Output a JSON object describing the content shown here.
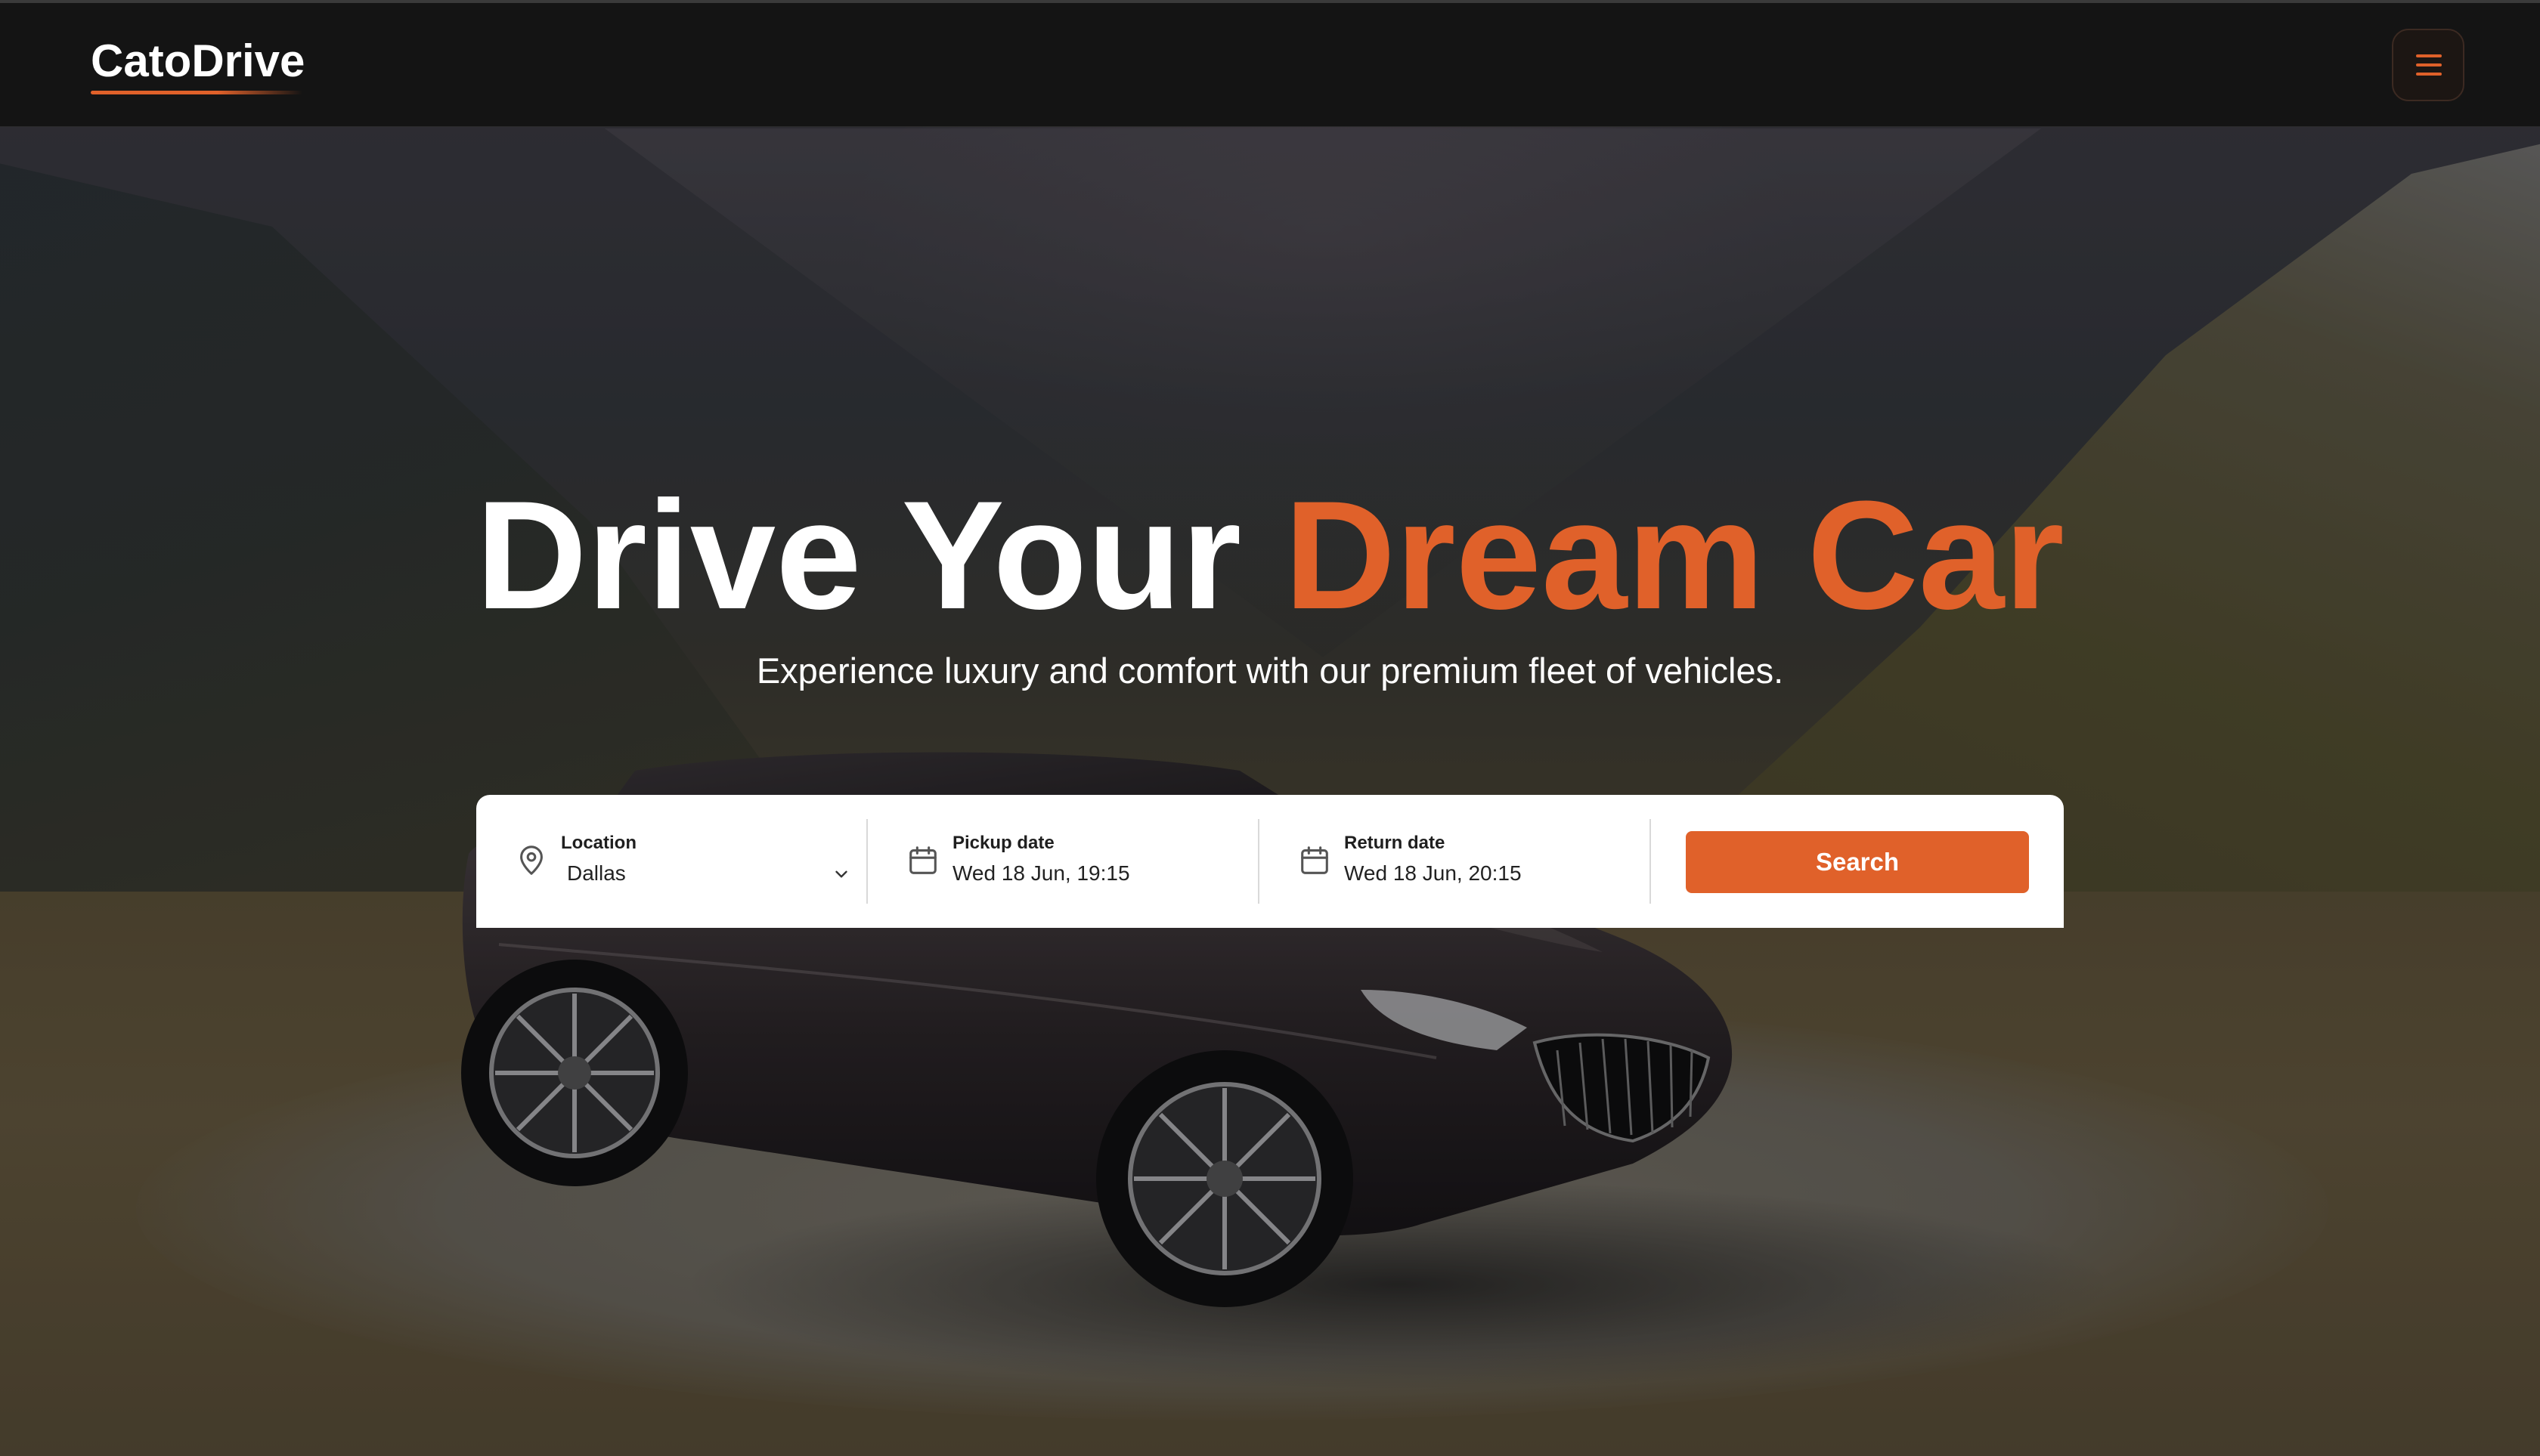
{
  "header": {
    "logo_text": "CatoDrive",
    "menu_icon": "hamburger-menu-icon"
  },
  "hero": {
    "title_part1": "Drive Your",
    "title_accent": "Dream Car",
    "subtitle": "Experience luxury and comfort with our premium fleet of vehicles."
  },
  "search": {
    "location": {
      "label": "Location",
      "value": "Dallas",
      "icon": "map-pin-icon"
    },
    "pickup": {
      "label": "Pickup date",
      "value": "Wed 18 Jun, 19:15",
      "icon": "calendar-icon"
    },
    "return": {
      "label": "Return date",
      "value": "Wed 18 Jun, 20:15",
      "icon": "calendar-icon"
    },
    "button_label": "Search"
  },
  "colors": {
    "accent": "#e0612a",
    "header_bg": "#141414",
    "text_light": "#ffffff"
  }
}
